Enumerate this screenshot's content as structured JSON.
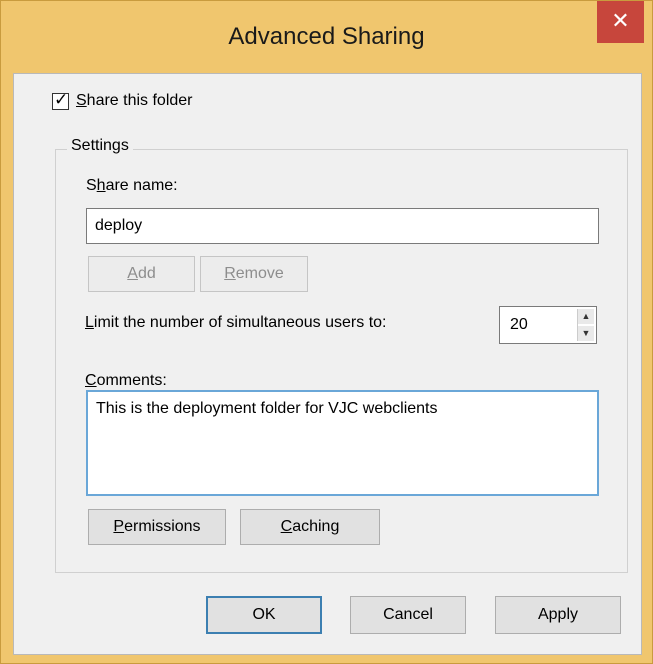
{
  "window": {
    "title": "Advanced Sharing",
    "close_glyph": "✕"
  },
  "share_checkbox": {
    "label": "Share this folder",
    "access_key": "S",
    "rest": "hare this folder",
    "checked": true
  },
  "settings": {
    "group_label": "Settings",
    "share_name": {
      "label_pre": "S",
      "label_key": "h",
      "label_post": "are name:",
      "value": "deploy"
    },
    "add_button": {
      "key": "A",
      "rest": "dd"
    },
    "remove_button": {
      "key": "R",
      "rest": "emove"
    },
    "limit": {
      "label_key": "L",
      "label_rest": "imit the number of simultaneous users to:",
      "value": "20"
    },
    "comments": {
      "label_key": "C",
      "label_rest": "omments:",
      "value": "This is the deployment folder for VJC webclients"
    },
    "permissions_button": {
      "key": "P",
      "rest": "ermissions"
    },
    "caching_button": {
      "key": "C",
      "rest": "aching"
    }
  },
  "buttons": {
    "ok": "OK",
    "cancel": "Cancel",
    "apply": "Apply"
  },
  "colors": {
    "titlebar": "#f0c66e",
    "close": "#c7463c",
    "focus_border": "#6aa7d8"
  }
}
